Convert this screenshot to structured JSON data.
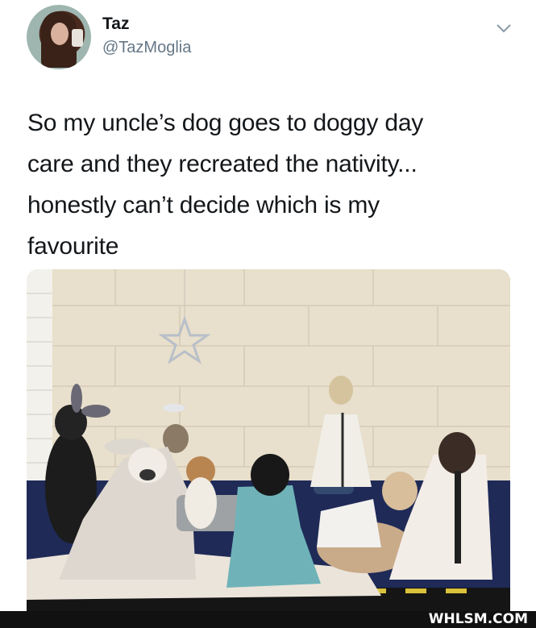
{
  "tweet": {
    "author_name": "Taz",
    "author_handle": "@TazMoglia",
    "text_lines": [
      "So my uncle’s dog goes to doggy day",
      "care and they recreated the nativity...",
      "honestly can’t decide which is my",
      "favourite"
    ]
  },
  "watermark": "WHLSM.COM"
}
